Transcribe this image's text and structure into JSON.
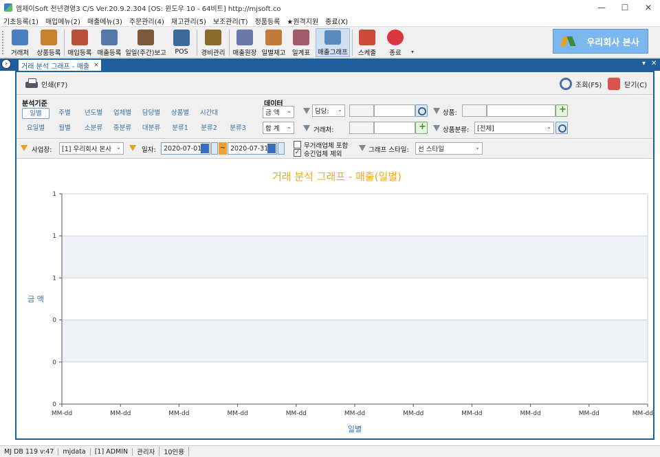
{
  "window": {
    "title": "엠제이Soft 천년경영3 C/S  Ver.20.9.2.304  [OS: 윈도우 10 - 64비트]   http://mjsoft.co",
    "controls": {
      "minimize": "—",
      "maximize": "☐",
      "close": "✕"
    }
  },
  "menu": [
    "기초등록(1)",
    "매입메뉴(2)",
    "매출메뉴(3)",
    "주문관리(4)",
    "재고관리(5)",
    "보조관리(T)",
    "정품등록",
    "★원격지원",
    "종료(X)"
  ],
  "toolbar": {
    "buttons": [
      {
        "label": "거래처",
        "color": "#4a7fc1"
      },
      {
        "label": "상품등록",
        "color": "#c8822e"
      },
      {
        "label": "매입등록",
        "color": "#b9513f"
      },
      {
        "label": "매출등록",
        "color": "#5479a8"
      },
      {
        "label": "일일(주간)보고",
        "color": "#7a5a3a"
      },
      {
        "label": "POS",
        "color": "#3e6a9a"
      },
      {
        "label": "경비관리",
        "color": "#8a6a2a"
      },
      {
        "label": "매출원장",
        "color": "#6a7aa8"
      },
      {
        "label": "일별재고",
        "color": "#c07a3a"
      },
      {
        "label": "일계표",
        "color": "#a05a6a"
      },
      {
        "label": "매출그래프",
        "color": "#5a8ac0"
      },
      {
        "label": "스케줄",
        "color": "#d04a3a"
      },
      {
        "label": "종료",
        "color": "#d9363e"
      }
    ],
    "hq_label": "우리회사 본사"
  },
  "tabs": {
    "active": "거래 분석 그래프 - 매출",
    "close": "×",
    "dropdown": "▾",
    "close_all": "✕",
    "nav": "›"
  },
  "subtoolbar": {
    "print": "인쇄(F7)",
    "search": "조회(F5)",
    "close": "닫기(C)"
  },
  "criteria": {
    "title": "분석기준",
    "row1": [
      "일별",
      "주별",
      "년도별",
      "업체별",
      "담당별",
      "상품별",
      "시간대"
    ],
    "row2": [
      "요일별",
      "월별",
      "소분류",
      "중분류",
      "대분류",
      "분류1",
      "분류2",
      "분류3"
    ],
    "selected": "일별"
  },
  "data_section": {
    "title": "데이터",
    "metric": "금 액",
    "aggregate": "합 계",
    "owner_label": "담당:",
    "customer_label": "거래처:",
    "product_label": "상품:",
    "category_label": "상품분류:",
    "category_value": "[전체]"
  },
  "filters": {
    "site_label": "사업장:",
    "site_value": "[1] 우리회사 본사",
    "date_label": "일자:",
    "date_from": "2020-07-01",
    "date_to": "2020-07-31",
    "tilde": "~",
    "check1": "무거래업체 포함",
    "check1_on": false,
    "check2": "승긴업체 제외",
    "check2_on": true,
    "style_label": "그래프 스타일:",
    "style_value": "선 스타일"
  },
  "chart_data": {
    "type": "line",
    "title": "거래 분석 그래프 - 매출(일별)",
    "xlabel": "일별",
    "ylabel": "금 액",
    "y_ticks": [
      "1",
      "1",
      "1",
      "0",
      "0",
      "0"
    ],
    "x_ticks": [
      "MM-dd",
      "MM-dd",
      "MM-dd",
      "MM-dd",
      "MM-dd",
      "MM-dd",
      "MM-dd",
      "MM-dd",
      "MM-dd",
      "MM-dd",
      "MM-dd"
    ],
    "series": [],
    "grid": true,
    "band_color": "#eef1f6"
  },
  "statusbar": [
    "MJ DB 119 v:47",
    "mjdata",
    "[1] ADMIN",
    "관리자",
    "10인용"
  ]
}
